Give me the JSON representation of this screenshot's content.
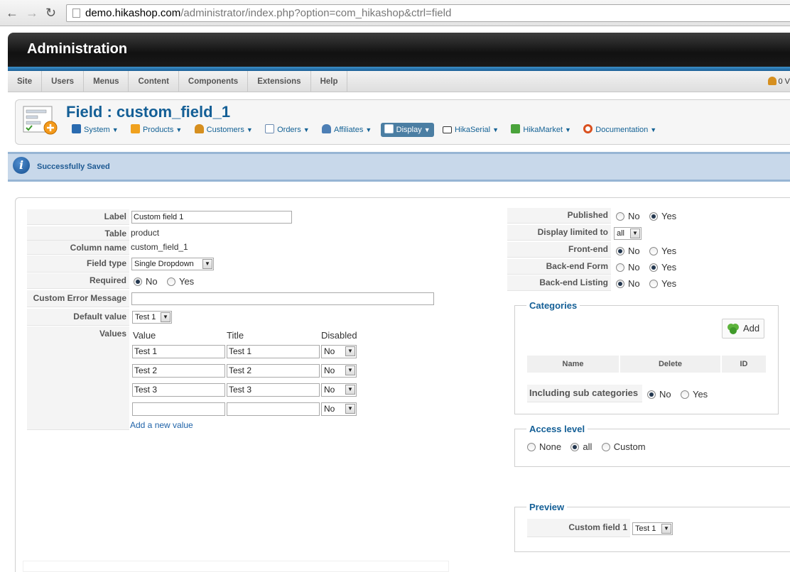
{
  "browser": {
    "url_host": "demo.hikashop.com",
    "url_path": "/administrator/index.php?option=com_hikashop&ctrl=field"
  },
  "admin": {
    "title": "Administration",
    "menu": [
      "Site",
      "Users",
      "Menus",
      "Content",
      "Components",
      "Extensions",
      "Help"
    ],
    "right_text": "0 V"
  },
  "toolbar": {
    "page_title": "Field : custom_field_1",
    "items": [
      {
        "label": "System",
        "icon": "wrench-icon",
        "color": "#2a6bb0"
      },
      {
        "label": "Products",
        "icon": "box-icon",
        "color": "#f0a11e"
      },
      {
        "label": "Customers",
        "icon": "users-icon",
        "color": "#d68f1f"
      },
      {
        "label": "Orders",
        "icon": "document-icon",
        "color": "#6d8bb1"
      },
      {
        "label": "Affiliates",
        "icon": "people-icon",
        "color": "#4d7fb5"
      },
      {
        "label": "Display",
        "icon": "display-icon",
        "color": "#ffffff"
      },
      {
        "label": "HikaSerial",
        "icon": "serial-icon",
        "color": "#333333"
      },
      {
        "label": "HikaMarket",
        "icon": "market-icon",
        "color": "#4aa33b"
      },
      {
        "label": "Documentation",
        "icon": "lifebuoy-icon",
        "color": "#d9501f"
      }
    ]
  },
  "message": {
    "text": "Successfully Saved"
  },
  "form": {
    "label": {
      "label": "Label",
      "value": "Custom field 1"
    },
    "table": {
      "label": "Table",
      "value": "product"
    },
    "column": {
      "label": "Column name",
      "value": "custom_field_1"
    },
    "field_type": {
      "label": "Field type",
      "value": "Single Dropdown"
    },
    "required": {
      "label": "Required",
      "options": [
        "No",
        "Yes"
      ],
      "selected": "No"
    },
    "error_message": {
      "label": "Custom Error Message",
      "value": ""
    },
    "default_value": {
      "label": "Default value",
      "value": "Test 1"
    },
    "values": {
      "label": "Values",
      "headers": [
        "Value",
        "Title",
        "Disabled"
      ],
      "rows": [
        {
          "value": "Test 1",
          "title": "Test 1",
          "disabled": "No"
        },
        {
          "value": "Test 2",
          "title": "Test 2",
          "disabled": "No"
        },
        {
          "value": "Test 3",
          "title": "Test 3",
          "disabled": "No"
        },
        {
          "value": "",
          "title": "",
          "disabled": "No"
        }
      ],
      "add_link": "Add a new value"
    }
  },
  "right": {
    "published": {
      "label": "Published",
      "options": [
        "No",
        "Yes"
      ],
      "selected": "Yes"
    },
    "display_limited": {
      "label": "Display limited to",
      "value": "all"
    },
    "frontend": {
      "label": "Front-end",
      "options": [
        "No",
        "Yes"
      ],
      "selected": "No"
    },
    "backend_form": {
      "label": "Back-end Form",
      "options": [
        "No",
        "Yes"
      ],
      "selected": "Yes"
    },
    "backend_listing": {
      "label": "Back-end Listing",
      "options": [
        "No",
        "Yes"
      ],
      "selected": "No"
    },
    "categories": {
      "legend": "Categories",
      "add_label": "Add",
      "headers": [
        "Name",
        "Delete",
        "ID"
      ],
      "sub_label": "Including sub categories",
      "sub_options": [
        "No",
        "Yes"
      ],
      "sub_selected": "No"
    },
    "access": {
      "legend": "Access level",
      "options": [
        "None",
        "all",
        "Custom"
      ],
      "selected": "all"
    },
    "preview": {
      "legend": "Preview",
      "label": "Custom field 1",
      "value": "Test 1"
    }
  }
}
